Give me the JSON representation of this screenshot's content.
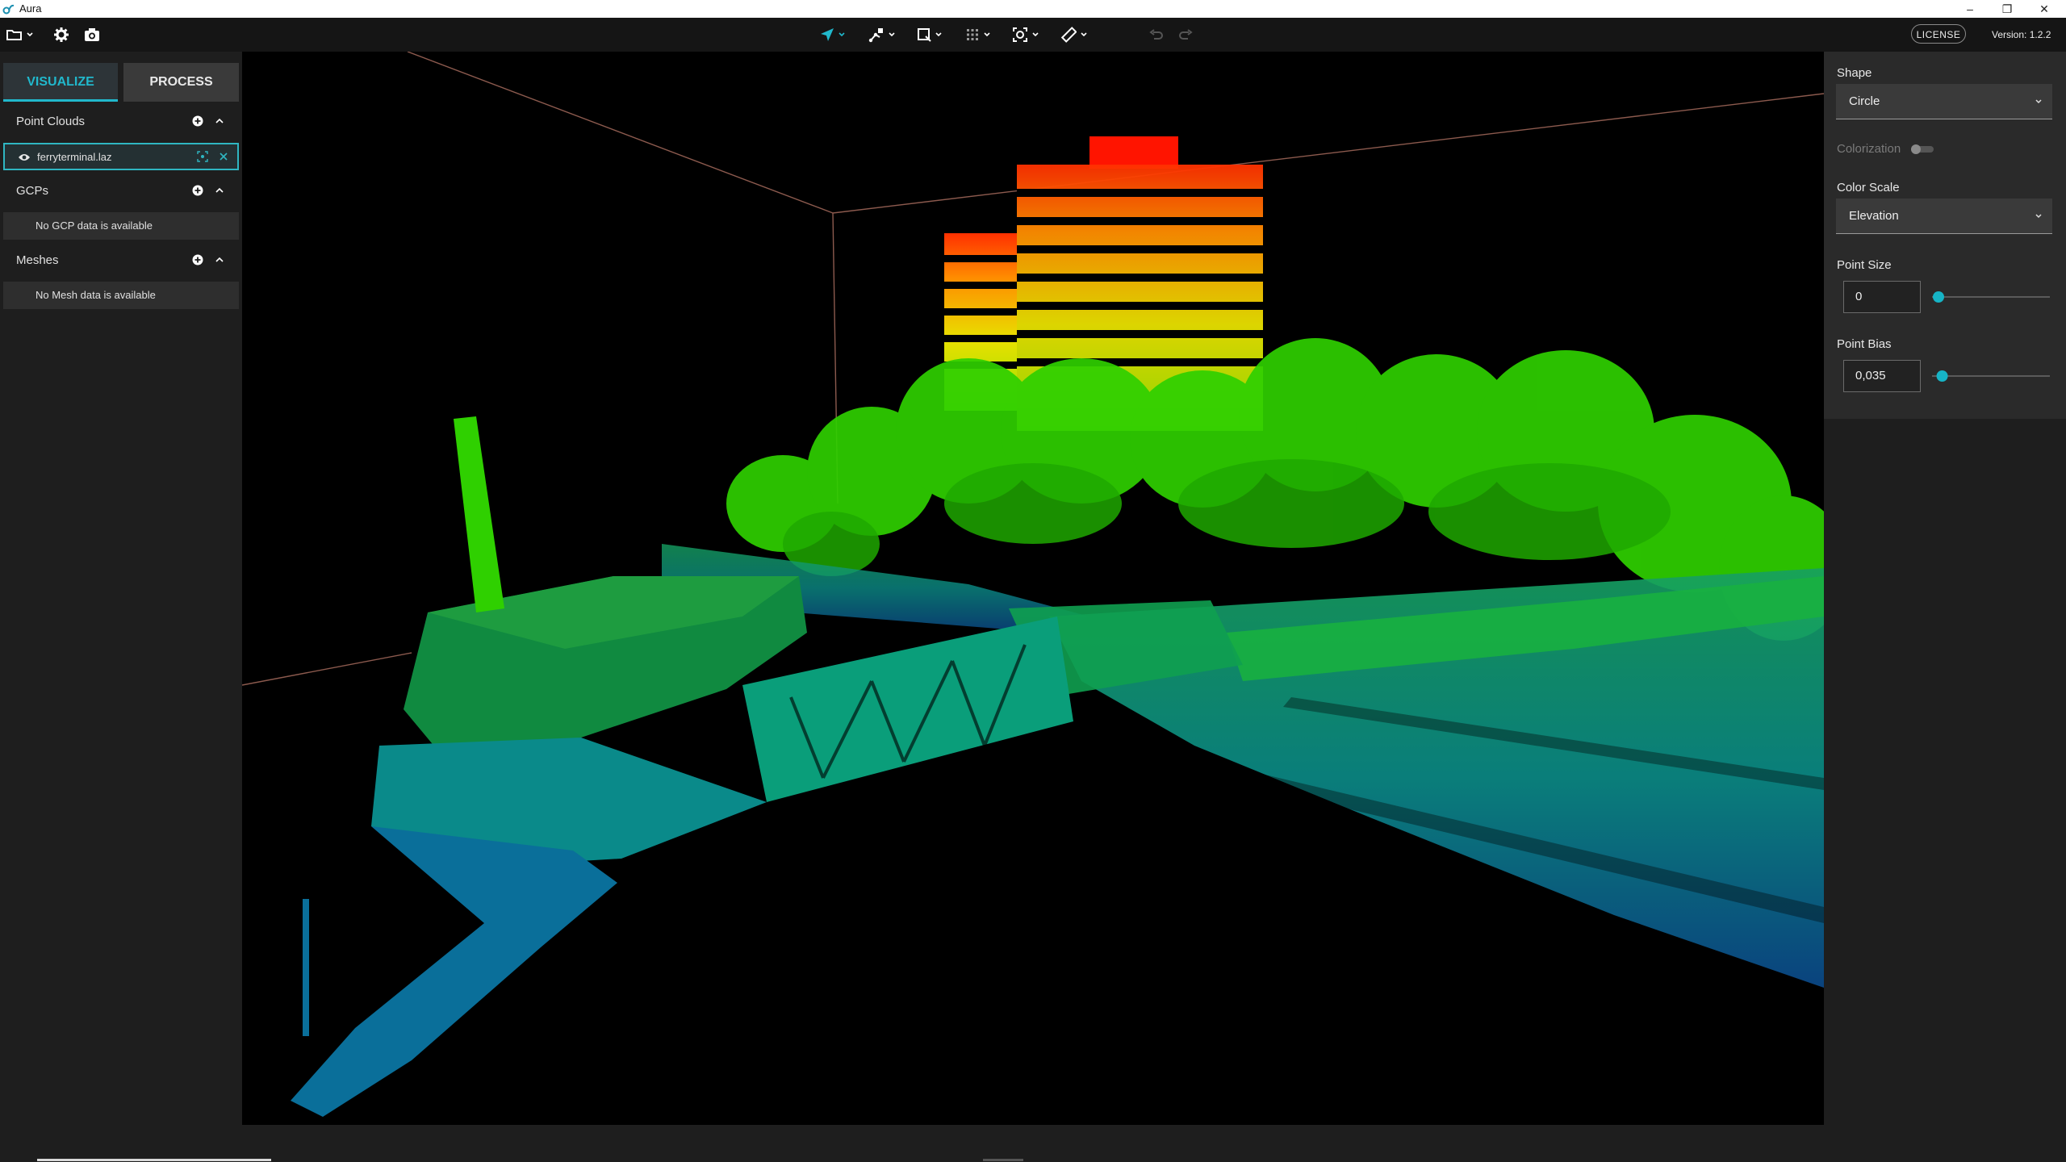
{
  "window": {
    "title": "Aura",
    "minimize": "–",
    "maximize": "❐",
    "close": "✕"
  },
  "toolbar": {
    "left_icons": [
      "folder-icon",
      "gear-icon",
      "camera-icon"
    ],
    "center_icons": [
      "navigate-icon",
      "point-pick-icon",
      "select-box-icon",
      "grid-icon",
      "scan-icon",
      "measure-icon",
      "undo-icon",
      "redo-icon"
    ],
    "license_label": "LICENSE",
    "version_label": "Version: 1.2.2"
  },
  "left_panel": {
    "tabs": [
      {
        "label": "VISUALIZE",
        "active": true
      },
      {
        "label": "PROCESS",
        "active": false
      }
    ],
    "sections": {
      "point_clouds": {
        "title": "Point Clouds",
        "items": [
          "ferryterminal.laz"
        ]
      },
      "gcps": {
        "title": "GCPs",
        "empty": "No GCP data is available"
      },
      "meshes": {
        "title": "Meshes",
        "empty": "No Mesh data is available"
      }
    }
  },
  "right_panel": {
    "shape_label": "Shape",
    "shape_value": "Circle",
    "colorization_label": "Colorization",
    "colorization_on": false,
    "color_scale_label": "Color Scale",
    "color_scale_value": "Elevation",
    "point_size_label": "Point Size",
    "point_size_value": "0",
    "point_size_slider": 0.0,
    "point_bias_label": "Point Bias",
    "point_bias_value": "0,035",
    "point_bias_slider": 0.035
  },
  "colors": {
    "accent": "#21b8cc",
    "panel": "#1e1e1e",
    "toolbar": "#151515",
    "viewport": "#000000",
    "bbox_line": "#8c5a4e"
  }
}
